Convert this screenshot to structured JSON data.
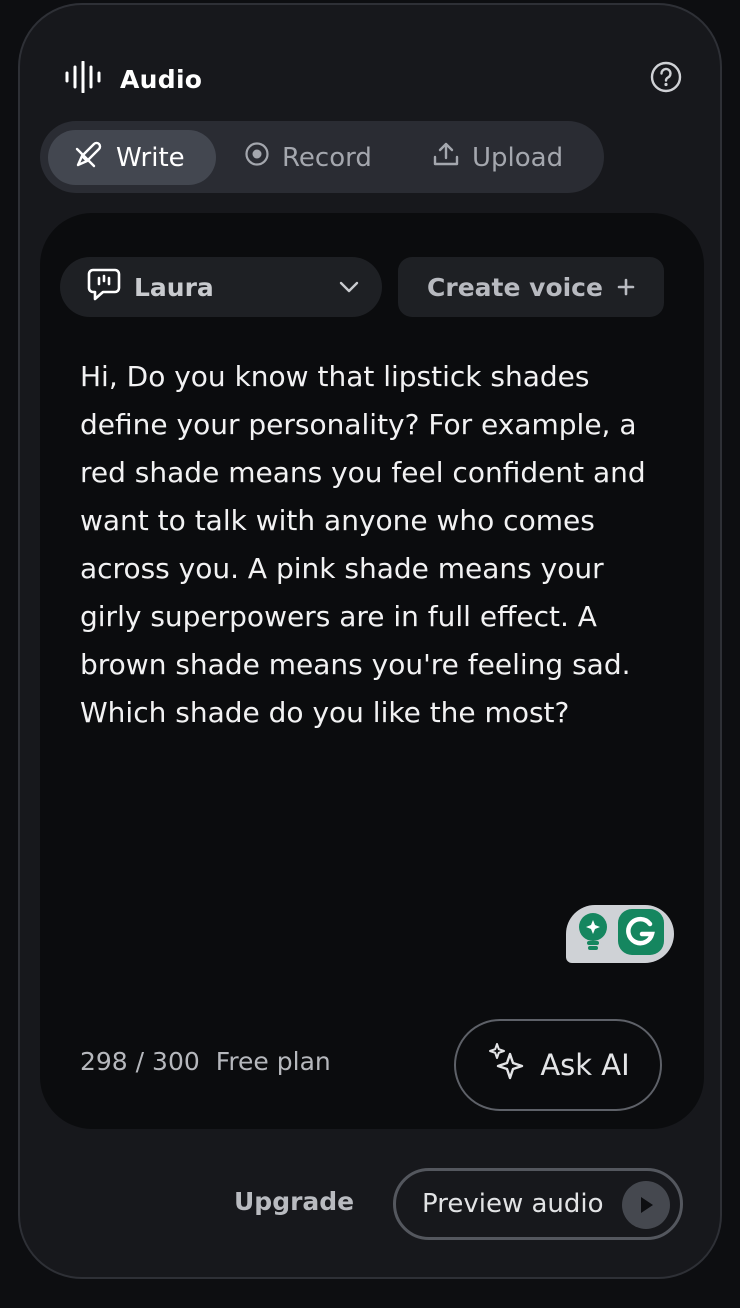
{
  "header": {
    "title": "Audio",
    "icon": "audio-wave-icon",
    "help_icon": "help-circle-icon"
  },
  "tabs": [
    {
      "label": "Write",
      "icon": "pen-icon",
      "active": true
    },
    {
      "label": "Record",
      "icon": "record-icon",
      "active": false
    },
    {
      "label": "Upload",
      "icon": "upload-icon",
      "active": false
    }
  ],
  "voice": {
    "selected": "Laura",
    "icon": "speech-bubble-icon",
    "create_label": "Create voice",
    "create_icon": "plus-icon"
  },
  "script": {
    "text": "Hi, Do you know that lipstick shades define your personality? For example, a red shade means you feel confident and want to talk with anyone who comes across you. A pink shade means your girly superpowers are in full effect. A brown shade means you're feeling sad. Which shade do you like the most?"
  },
  "counter": {
    "count": "298 / 300",
    "plan": "Free plan"
  },
  "ask_ai": {
    "label": "Ask AI",
    "icon": "sparkle-icon"
  },
  "footer": {
    "upgrade_label": "Upgrade",
    "preview_label": "Preview audio",
    "play_icon": "play-icon"
  },
  "colors": {
    "background": "#0d0e11",
    "panel": "#17181c",
    "card": "#0b0c0e",
    "grammarly_green": "#15865f"
  }
}
